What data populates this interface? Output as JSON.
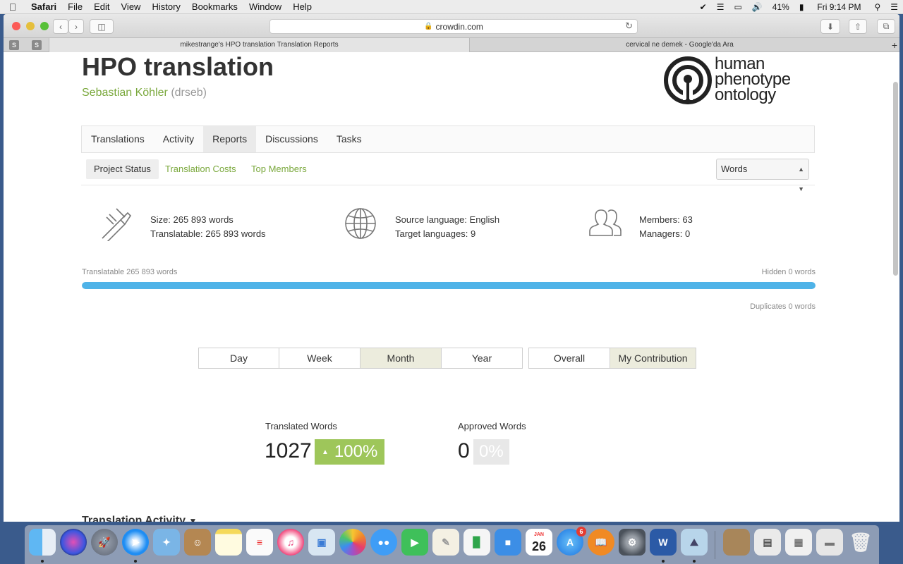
{
  "menubar": {
    "app_name": "Safari",
    "items": [
      "File",
      "Edit",
      "View",
      "History",
      "Bookmarks",
      "Window",
      "Help"
    ],
    "battery": "41%",
    "clock": "Fri 9:14 PM"
  },
  "browser": {
    "url": "crowdin.com",
    "pinned_tab_letter": "S",
    "tabs": [
      {
        "title": "mikestrange's HPO translation Translation Reports"
      },
      {
        "title": "cervical ne demek - Google'da Ara"
      }
    ],
    "new_tab_symbol": "+"
  },
  "project": {
    "title": "HPO translation",
    "owner_name": "Sebastian Köhler",
    "owner_handle": "(drseb)",
    "logo_lines": [
      "human",
      "phenotype",
      "ontology"
    ]
  },
  "nav": {
    "tabs": [
      "Translations",
      "Activity",
      "Reports",
      "Discussions",
      "Tasks"
    ],
    "active": "Reports"
  },
  "subnav": {
    "tabs": [
      "Project Status",
      "Translation Costs",
      "Top Members"
    ],
    "active": "Project Status",
    "unit_select": "Words"
  },
  "stats": {
    "size": "Size: 265 893 words",
    "translatable": "Translatable: 265 893 words",
    "source_language": "Source language: English",
    "target_languages": "Target languages: 9",
    "members": "Members: 63",
    "managers": "Managers: 0"
  },
  "progress": {
    "left_label": "Translatable 265 893 words",
    "right_label": "Hidden 0 words",
    "duplicates_label": "Duplicates 0 words",
    "translatable_fraction": 1.0
  },
  "period_buttons": [
    "Day",
    "Week",
    "Month",
    "Year"
  ],
  "period_active": "Month",
  "scope_buttons": [
    "Overall",
    "My Contribution"
  ],
  "scope_active": "My Contribution",
  "metrics": {
    "translated": {
      "label": "Translated Words",
      "value": "1027",
      "change": "100%",
      "change_symbol": "▲"
    },
    "approved": {
      "label": "Approved Words",
      "value": "0",
      "change": "0%"
    }
  },
  "section": {
    "title": "Translation Activity"
  },
  "dock": {
    "calendar_month": "JAN",
    "calendar_day": "26",
    "app_store_badge": "6",
    "word_letter": "W"
  },
  "colors": {
    "accent_green": "#7aa83c",
    "progress_blue": "#4fb3e8",
    "badge_green": "#9ec65a"
  }
}
